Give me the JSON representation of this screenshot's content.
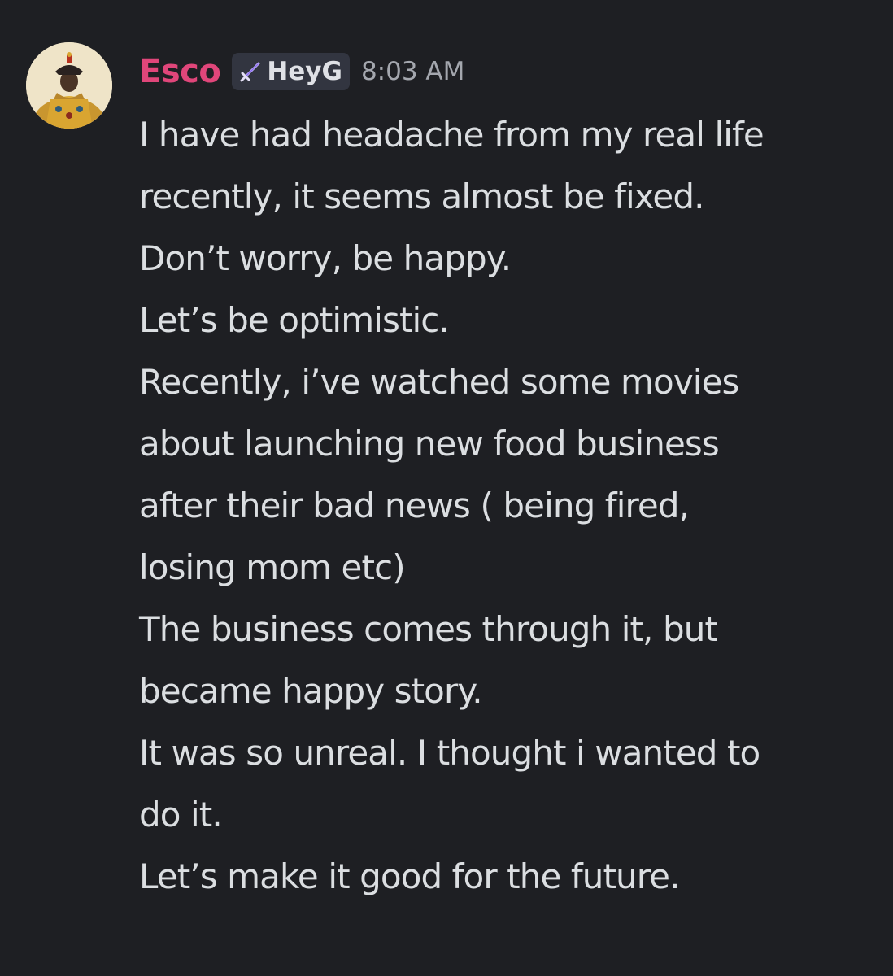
{
  "message": {
    "avatar_icon": "emperor-portrait-avatar",
    "username": "Esco",
    "username_color": "#e0467a",
    "tag": {
      "icon": "sword-icon",
      "label": "HeyG"
    },
    "timestamp": "8:03 AM",
    "lines": [
      "I have had headache from my real life",
      "recently, it seems almost be fixed.",
      "Don’t worry, be happy.",
      "Let’s be optimistic.",
      "Recently, i’ve watched some movies",
      "about launching new food business",
      "after their bad news ( being fired,",
      "losing mom etc)",
      "The business comes through it, but",
      "became happy story.",
      "It was so unreal. I thought i wanted to",
      "do it.",
      "Let’s make it good for the future."
    ]
  }
}
